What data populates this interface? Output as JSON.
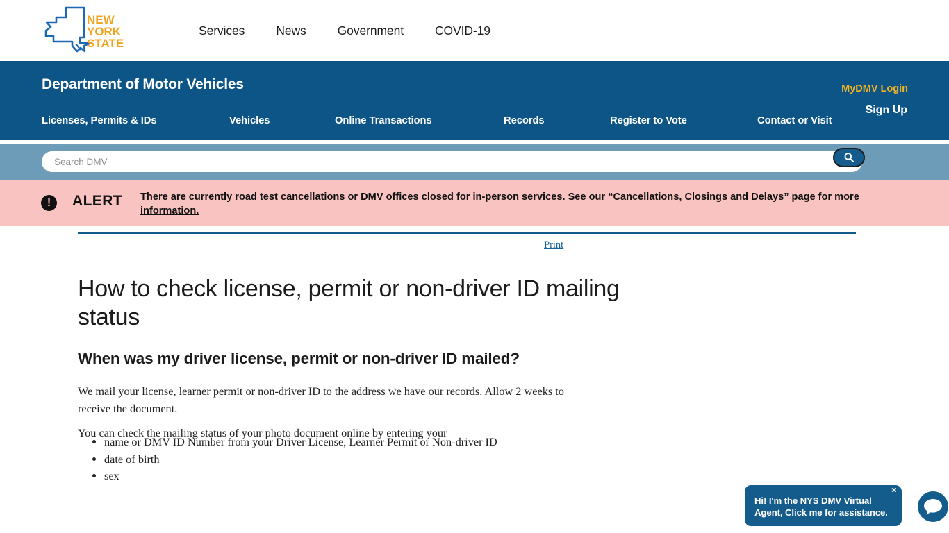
{
  "topbar": {
    "logo": {
      "name": "new-york-state-logo",
      "line1": "NEW",
      "line2": "YORK",
      "line3": "STATE",
      "outline_color": "#1d68b3",
      "text_color": "#f0a41e"
    },
    "nav": [
      {
        "label": "Services"
      },
      {
        "label": "News"
      },
      {
        "label": "Government"
      },
      {
        "label": "COVID-19"
      }
    ]
  },
  "dmv_header": {
    "title": "Department of Motor Vehicles",
    "login_label": "MyDMV Login",
    "signup_label": "Sign Up",
    "background_color": "#0d5587",
    "login_color": "#f0b323",
    "nav": [
      {
        "label": "Licenses, Permits & IDs"
      },
      {
        "label": "Vehicles"
      },
      {
        "label": "Online Transactions"
      },
      {
        "label": "Records"
      },
      {
        "label": "Register to Vote"
      },
      {
        "label": "Contact or Visit"
      }
    ]
  },
  "search": {
    "placeholder": "Search DMV",
    "value": "",
    "button_icon": "search-icon",
    "band_color": "#6d9cb9",
    "button_color": "#145c8c"
  },
  "alert": {
    "icon": "exclamation-circle-icon",
    "label": "ALERT",
    "message": "There are currently road test cancellations or DMV offices closed for in-person services. See our “Cancellations, Closings and Delays” page for more information.",
    "background_color": "#f9c3c1"
  },
  "main": {
    "print_label": "Print",
    "page_title": "How to check license, permit or non-driver ID mailing status",
    "section_heading": "When was my driver license, permit or non-driver ID mailed?",
    "paragraph_1": "We mail your license, learner permit or non-driver ID to the address we have our records. Allow 2 weeks to receive the document.",
    "paragraph_2": "You can check the mailing status of your photo document online by entering your",
    "bullets": [
      "name or DMV ID Number from your Driver License, Learner Permit or Non-driver ID",
      "date of birth",
      "sex"
    ],
    "rule_color": "#105a8c"
  },
  "chat_widget": {
    "message": "Hi! I'm the NYS DMV Virtual Agent, Click me for assistance.",
    "close_label": "×",
    "icon": "chat-bubble-icon",
    "color": "#145c8c"
  }
}
